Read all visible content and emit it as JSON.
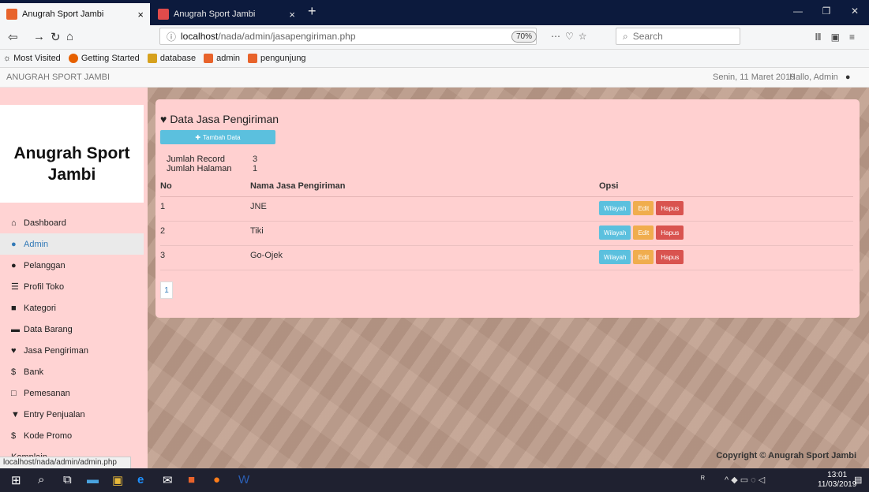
{
  "browser": {
    "tabs": [
      {
        "label": "Anugrah Sport Jambi",
        "close": "×"
      },
      {
        "label": "Anugrah Sport Jambi",
        "close": "×"
      }
    ],
    "new_tab": "+",
    "url_host": "localhost",
    "url_path": "/nada/admin/jasapengiriman.php",
    "zoom": "70%",
    "search_placeholder": "Search",
    "bookmarks": [
      "Most Visited",
      "Getting Started",
      "database",
      "admin",
      "pengunjung"
    ],
    "status_url": "localhost/nada/admin/admin.php"
  },
  "site": {
    "brand": "ANUGRAH SPORT JAMBI",
    "date": "Senin, 11 Maret 2019",
    "greeting": "Hallo, Admin",
    "logo_line1": "Anugrah Sport",
    "logo_line2": "Jambi",
    "copyright": "Copyright © Anugrah Sport Jambi"
  },
  "sidebar": {
    "items": [
      {
        "label": "Dashboard",
        "icon": "home-icon"
      },
      {
        "label": "Admin",
        "icon": "user-icon"
      },
      {
        "label": "Pelanggan",
        "icon": "user-icon"
      },
      {
        "label": "Profil Toko",
        "icon": "list-icon"
      },
      {
        "label": "Kategori",
        "icon": "book-icon"
      },
      {
        "label": "Data Barang",
        "icon": "folder-icon"
      },
      {
        "label": "Jasa Pengiriman",
        "icon": "map-marker-icon"
      },
      {
        "label": "Bank",
        "icon": "dollar-icon"
      },
      {
        "label": "Pemesanan",
        "icon": "cart-icon"
      },
      {
        "label": "Entry Penjualan",
        "icon": "cart-icon"
      },
      {
        "label": "Kode Promo",
        "icon": "dollar-icon"
      },
      {
        "label": "Komplain",
        "icon": ""
      }
    ],
    "active_index": 1
  },
  "main": {
    "title": "Data Jasa Pengiriman",
    "add_button": "Tambah Data",
    "record_label": "Jumlah Record",
    "record_value": "3",
    "pages_label": "Jumlah Halaman",
    "pages_value": "1",
    "columns": [
      "No",
      "Nama Jasa Pengiriman",
      "Opsi"
    ],
    "rows": [
      {
        "no": "1",
        "nama": "JNE"
      },
      {
        "no": "2",
        "nama": "Tiki"
      },
      {
        "no": "3",
        "nama": "Go-Ojek"
      }
    ],
    "actions": {
      "wilayah": "Wilayah",
      "edit": "Edit",
      "hapus": "Hapus"
    },
    "current_page": "1"
  },
  "taskbar": {
    "time": "13:01",
    "date": "11/03/2019"
  }
}
